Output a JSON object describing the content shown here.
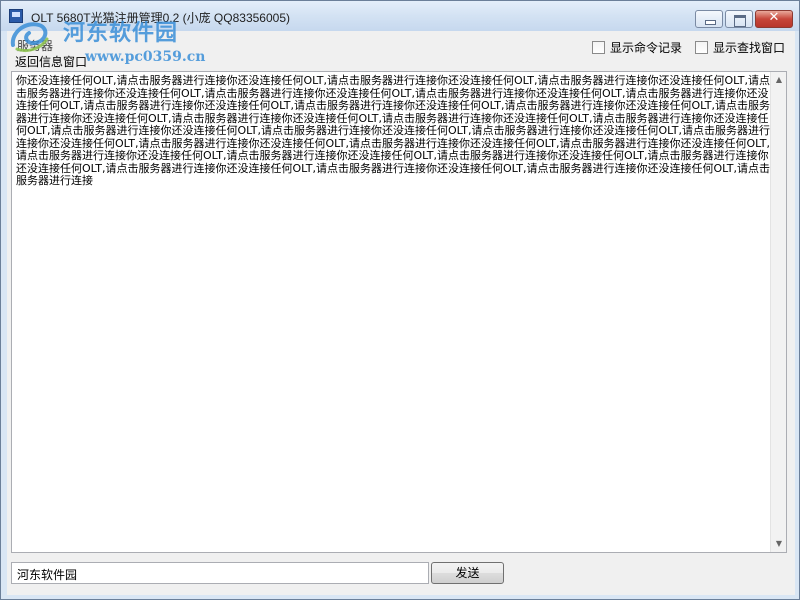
{
  "window": {
    "title": "OLT 5680T光猫注册管理0.2 (小庞 QQ83356005)",
    "close_glyph": "✕"
  },
  "watermark": {
    "logo_text": "河东软件园",
    "url": "www.pc0359.cn"
  },
  "header": {
    "server_label": "服务器",
    "group_label": "返回信息窗口",
    "show_command_log_label": "显示命令记录",
    "show_command_log_checked": false,
    "show_search_window_label": "显示查找窗口",
    "show_search_window_checked": false
  },
  "log": {
    "text": "你还没连接任何OLT,请点击服务器进行连接你还没连接任何OLT,请点击服务器进行连接你还没连接任何OLT,请点击服务器进行连接你还没连接任何OLT,请点击服务器进行连接你还没连接任何OLT,请点击服务器进行连接你还没连接任何OLT,请点击服务器进行连接你还没连接任何OLT,请点击服务器进行连接你还没连接任何OLT,请点击服务器进行连接你还没连接任何OLT,请点击服务器进行连接你还没连接任何OLT,请点击服务器进行连接你还没连接任何OLT,请点击服务器进行连接你还没连接任何OLT,请点击服务器进行连接你还没连接任何OLT,请点击服务器进行连接你还没连接任何OLT,请点击服务器进行连接你还没连接任何OLT,请点击服务器进行连接你还没连接任何OLT,请点击服务器进行连接你还没连接任何OLT,请点击服务器进行连接你还没连接任何OLT,请点击服务器进行连接你还没连接任何OLT,请点击服务器进行连接你还没连接任何OLT,请点击服务器进行连接你还没连接任何OLT,请点击服务器进行连接你还没连接任何OLT,请点击服务器进行连接你还没连接任何OLT,请点击服务器进行连接你还没连接任何OLT,请点击服务器进行连接你还没连接任何OLT,请点击服务器进行连接你还没连接任何OLT,请点击服务器进行连接你还没连接任何OLT,请点击服务器进行连接你还没连接任何OLT,请点击服务器进行连接你还没连接任何OLT,请点击服务器进行连接"
  },
  "send": {
    "input_value": "河东软件园",
    "button_label": "发送"
  },
  "icons": {
    "app": "app-icon",
    "minimize": "minimize-icon",
    "maximize": "maximize-icon",
    "close": "close-icon",
    "scroll_up": "scroll-up-arrow-icon",
    "scroll_down": "scroll-down-arrow-icon"
  },
  "colors": {
    "title_gradient_top": "#e4eefa",
    "close_button": "#c7463a",
    "watermark": "#3a8fd8"
  }
}
